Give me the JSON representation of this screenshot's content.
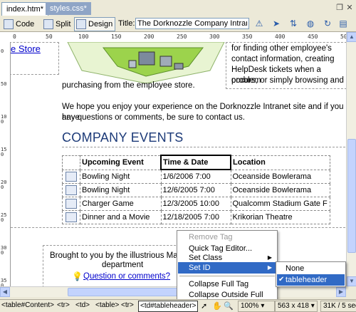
{
  "tabs": [
    {
      "label": "index.htm*",
      "active": true
    },
    {
      "label": "styles.css*",
      "active": false
    }
  ],
  "toolbar": {
    "code_label": "Code",
    "split_label": "Split",
    "design_label": "Design",
    "title_label": "Title:",
    "title_value": "The Dorknozzle Company Intranet"
  },
  "ruler": {
    "h_ticks": [
      "0",
      "50",
      "100",
      "150",
      "200",
      "250",
      "300",
      "350",
      "400",
      "450",
      "500"
    ],
    "v_ticks": [
      "0",
      "50",
      "100",
      "150",
      "200",
      "250",
      "300",
      "350"
    ]
  },
  "page": {
    "store_link": "e Store",
    "intro_lines": [
      "for finding other employee's",
      "contact information, creating",
      "HelpDesk tickets when a problem",
      "occurs, or simply browsing and"
    ],
    "intro_last": "purchasing from the employee store.",
    "hope_line1": "We hope you enjoy your experience on the Dorknozzle Intranet site and if you have",
    "hope_line2": "any questions or comments, be sure to contact us.",
    "events_heading": "COMPANY EVENTS",
    "table": {
      "headers": [
        "Upcoming Event",
        "Time & Date",
        "Location"
      ],
      "rows": [
        [
          "Bowling Night",
          "1/6/2006 7:00",
          "Oceanside Bowlerama"
        ],
        [
          "Bowling Night",
          "12/6/2005 7:00",
          "Oceanside Bowlerama"
        ],
        [
          "Charger Game",
          "12/3/2005 10:00",
          "Qualcomm Stadium Gate F"
        ],
        [
          "Dinner and a Movie",
          "12/18/2005 7:00",
          "Krikorian Theatre"
        ]
      ]
    },
    "footer_line1": "Brought to you by the illustrious Marke",
    "footer_line2": "department",
    "footer_link": "Question or comments?"
  },
  "context_menu": {
    "items": [
      {
        "label": "Remove Tag",
        "disabled": true,
        "submenu": false
      },
      {
        "label": "Quick Tag Editor...",
        "disabled": false,
        "submenu": false
      },
      {
        "label": "Set Class",
        "disabled": false,
        "submenu": true
      },
      {
        "label": "Set ID",
        "disabled": false,
        "submenu": true,
        "highlighted": true
      },
      {
        "label": "Collapse Full Tag",
        "disabled": false,
        "submenu": false
      },
      {
        "label": "Collapse Outside Full Tag",
        "disabled": false,
        "submenu": false
      }
    ],
    "submenu": {
      "items": [
        {
          "label": "None",
          "checked": false
        },
        {
          "label": "tableheader",
          "checked": true,
          "highlighted": true
        }
      ]
    }
  },
  "status": {
    "tags": [
      "<table#Content>",
      "<tr>",
      "<td>",
      "<table>",
      "<tr>",
      "<td#tableheader>"
    ],
    "zoom": "100%",
    "dimensions": "563 x 418",
    "size_time": "31K / 5 sec"
  },
  "colors": {
    "menu_highlight": "#316AC5",
    "heading": "#1C3A78",
    "link": "#0000CC"
  }
}
